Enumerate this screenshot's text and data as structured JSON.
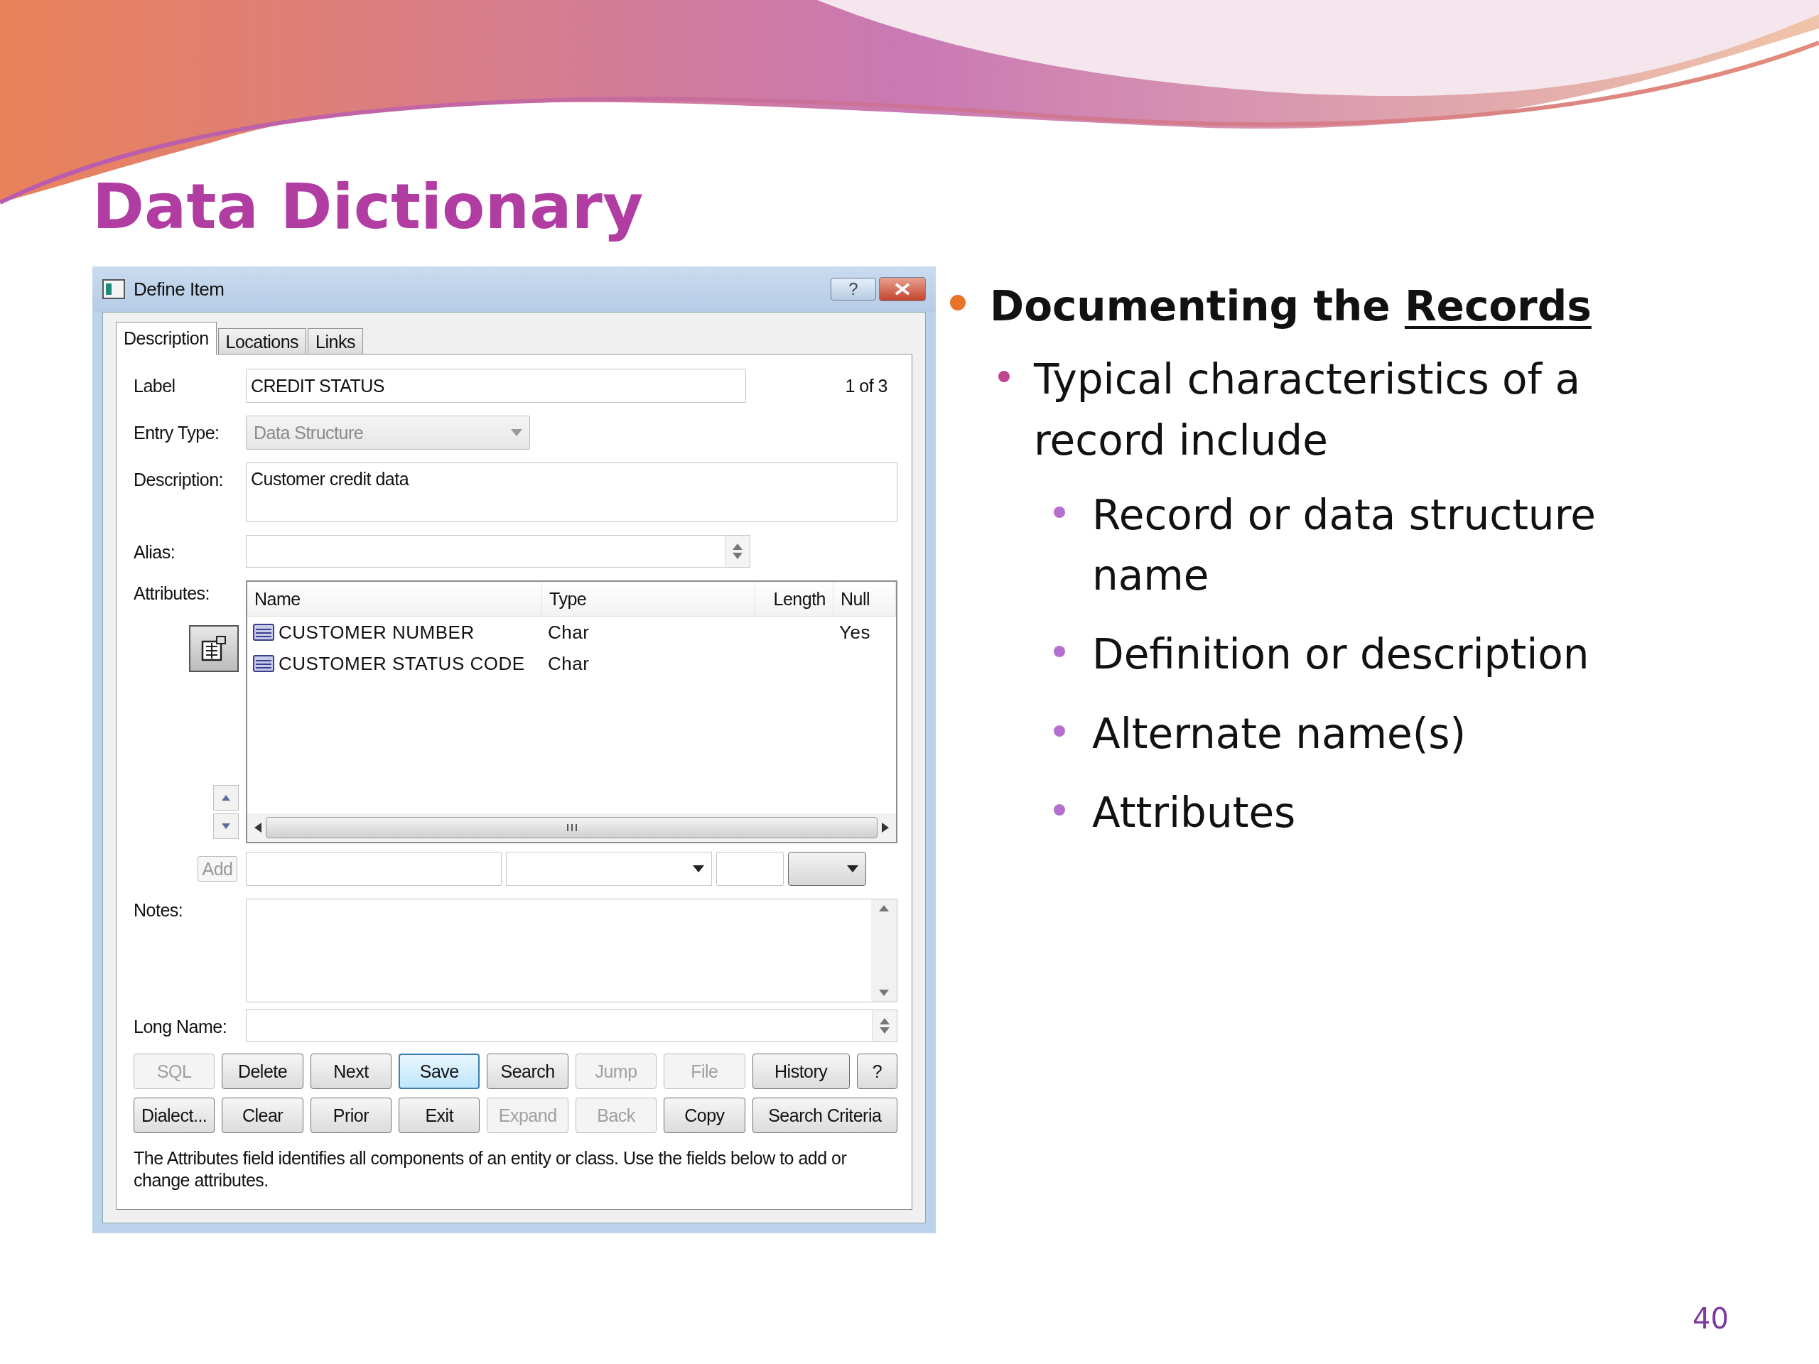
{
  "slide": {
    "title": "Data Dictionary",
    "page_number": "40"
  },
  "dialog": {
    "title": "Define Item",
    "help_button": "?",
    "tabs": [
      {
        "label": "Description",
        "selected": true
      },
      {
        "label": "Locations",
        "selected": false
      },
      {
        "label": "Links",
        "selected": false
      }
    ],
    "label_field": {
      "label": "Label",
      "value": "CREDIT STATUS"
    },
    "counter": "1 of 3",
    "entry_type": {
      "label": "Entry Type:",
      "value": "Data Structure",
      "disabled": true
    },
    "description": {
      "label": "Description:",
      "value": "Customer credit data"
    },
    "alias": {
      "label": "Alias:"
    },
    "attributes": {
      "label": "Attributes:",
      "columns": [
        "Name",
        "Type",
        "Length",
        "Null"
      ],
      "rows": [
        {
          "name": "CUSTOMER NUMBER",
          "type": "Char",
          "null": "Yes"
        },
        {
          "name": "CUSTOMER STATUS CODE",
          "type": "Char"
        }
      ]
    },
    "add_button": {
      "label": "Add",
      "disabled": true
    },
    "notes": {
      "label": "Notes:"
    },
    "long_name": {
      "label": "Long Name:"
    },
    "button_rows": [
      [
        {
          "label": "SQL",
          "disabled": true,
          "selected": false
        },
        {
          "label": "Delete",
          "disabled": false,
          "selected": false
        },
        {
          "label": "Next",
          "disabled": false,
          "selected": false
        },
        {
          "label": "Save",
          "disabled": false,
          "selected": true
        },
        {
          "label": "Search",
          "disabled": false,
          "selected": false
        },
        {
          "label": "Jump",
          "disabled": true,
          "selected": false
        },
        {
          "label": "File",
          "disabled": true,
          "selected": false
        },
        {
          "label": "History",
          "disabled": false,
          "selected": false
        },
        {
          "label": "?",
          "disabled": false,
          "selected": false
        }
      ],
      [
        {
          "label": "Dialect...",
          "disabled": false,
          "selected": false
        },
        {
          "label": "Clear",
          "disabled": false,
          "selected": false
        },
        {
          "label": "Prior",
          "disabled": false,
          "selected": false
        },
        {
          "label": "Exit",
          "disabled": false,
          "selected": false
        },
        {
          "label": "Expand",
          "disabled": true,
          "selected": false
        },
        {
          "label": "Back",
          "disabled": true,
          "selected": false
        },
        {
          "label": "Copy",
          "disabled": false,
          "selected": false
        },
        {
          "label": "Search Criteria",
          "disabled": false,
          "selected": false
        }
      ]
    ],
    "hint": "The Attributes field identifies all components of an entity or class. Use the fields below to add or change attributes."
  },
  "bullets": [
    {
      "text": "Documenting the ",
      "emphasis": "Records",
      "children": [
        {
          "text": "Typical characteristics of a record include",
          "children": [
            {
              "text": "Record or data structure name"
            },
            {
              "text": "Definition or description"
            },
            {
              "text": "Alternate name(s)"
            },
            {
              "text": "Attributes"
            }
          ]
        }
      ]
    }
  ]
}
